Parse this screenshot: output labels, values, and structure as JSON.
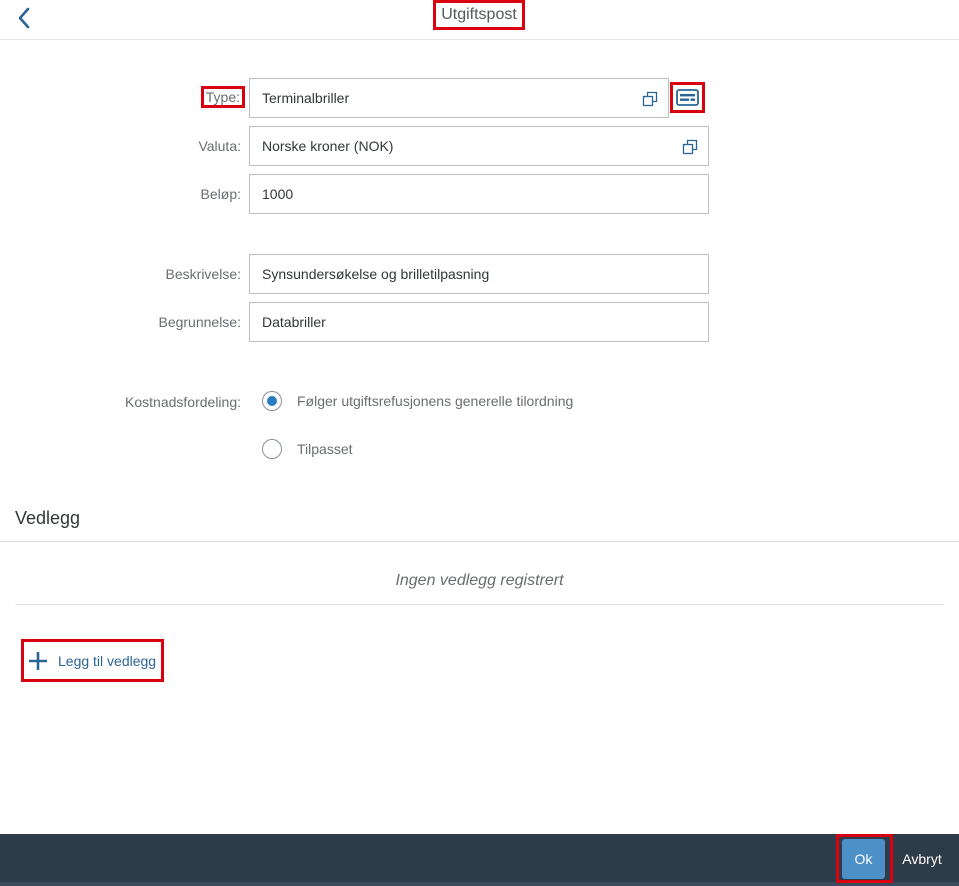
{
  "header": {
    "title": "Utgiftspost"
  },
  "form": {
    "type": {
      "label": "Type:",
      "value": "Terminalbriller"
    },
    "currency": {
      "label": "Valuta:",
      "value": "Norske kroner (NOK)"
    },
    "amount": {
      "label": "Beløp:",
      "value": "1000"
    },
    "description": {
      "label": "Beskrivelse:",
      "value": "Synsundersøkelse og brilletilpasning"
    },
    "justification": {
      "label": "Begrunnelse:",
      "value": "Databriller"
    },
    "cost_distribution": {
      "label": "Kostnadsfordeling:",
      "options": [
        {
          "label": "Følger utgiftsrefusjonens generelle tilordning",
          "selected": true
        },
        {
          "label": "Tilpasset",
          "selected": false
        }
      ]
    }
  },
  "attachments": {
    "title": "Vedlegg",
    "empty_text": "Ingen vedlegg registrert",
    "add_label": "Legg til vedlegg"
  },
  "footer": {
    "ok_label": "Ok",
    "cancel_label": "Avbryt"
  },
  "colors": {
    "accent": "#2b7bc2",
    "footer_bg": "#2e3b48",
    "highlight": "#d9000f",
    "link": "#2a6597"
  },
  "icons": [
    "chevron-left-icon",
    "value-help-icon",
    "card-icon",
    "plus-icon"
  ]
}
